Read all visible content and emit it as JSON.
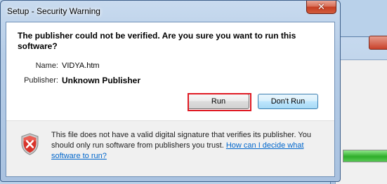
{
  "dialog": {
    "title": "Setup - Security Warning",
    "close_label": "✕",
    "question": "The publisher could not be verified.  Are you sure you want to run this software?",
    "fields": [
      {
        "label": "Name:",
        "value": "VIDYA.htm"
      },
      {
        "label": "Publisher:",
        "value": "Unknown Publisher"
      }
    ],
    "buttons": {
      "run": "Run",
      "dont_run": "Don't Run"
    },
    "footer": {
      "text": "This file does not have a valid digital signature that verifies its publisher. You should only run software from publishers you trust. ",
      "link": "How can I decide what software to run?"
    },
    "icons": {
      "warning": "shield-error-icon"
    }
  },
  "background_window": {
    "progress": 1.0
  },
  "colors": {
    "highlight": "#e01b24",
    "link": "#0066cc",
    "close_button": "#c53d22",
    "progress_green": "#2eae2a"
  }
}
